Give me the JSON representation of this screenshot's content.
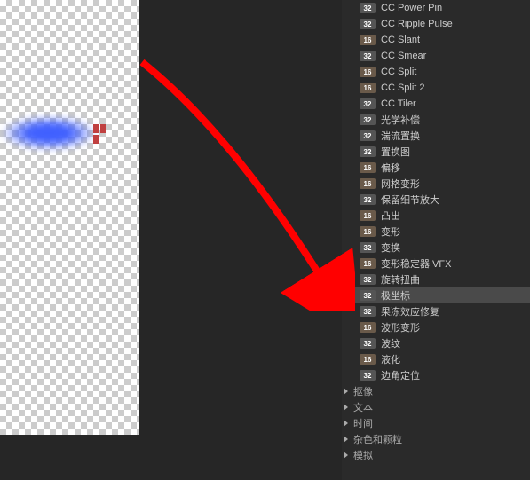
{
  "effects": [
    {
      "badge": "32",
      "label": "CC Power Pin"
    },
    {
      "badge": "32",
      "label": "CC Ripple Pulse"
    },
    {
      "badge": "16",
      "label": "CC Slant"
    },
    {
      "badge": "32",
      "label": "CC Smear"
    },
    {
      "badge": "16",
      "label": "CC Split"
    },
    {
      "badge": "16",
      "label": "CC Split 2"
    },
    {
      "badge": "32",
      "label": "CC Tiler"
    },
    {
      "badge": "32",
      "label": "光学补偿"
    },
    {
      "badge": "32",
      "label": "湍流置换"
    },
    {
      "badge": "32",
      "label": "置换图"
    },
    {
      "badge": "16",
      "label": "偏移"
    },
    {
      "badge": "16",
      "label": "网格变形"
    },
    {
      "badge": "32",
      "label": "保留细节放大"
    },
    {
      "badge": "16",
      "label": "凸出"
    },
    {
      "badge": "16",
      "label": "变形"
    },
    {
      "badge": "32",
      "label": "变换"
    },
    {
      "badge": "16",
      "label": "变形稳定器 VFX"
    },
    {
      "badge": "32",
      "label": "旋转扭曲"
    },
    {
      "badge": "32",
      "label": "极坐标",
      "selected": true
    },
    {
      "badge": "32",
      "label": "果冻效应修复"
    },
    {
      "badge": "16",
      "label": "波形变形"
    },
    {
      "badge": "32",
      "label": "波纹"
    },
    {
      "badge": "16",
      "label": "液化"
    },
    {
      "badge": "32",
      "label": "边角定位"
    }
  ],
  "categories": [
    {
      "label": "抠像"
    },
    {
      "label": "文本"
    },
    {
      "label": "时间"
    },
    {
      "label": "杂色和颗粒"
    },
    {
      "label": "模拟"
    }
  ]
}
